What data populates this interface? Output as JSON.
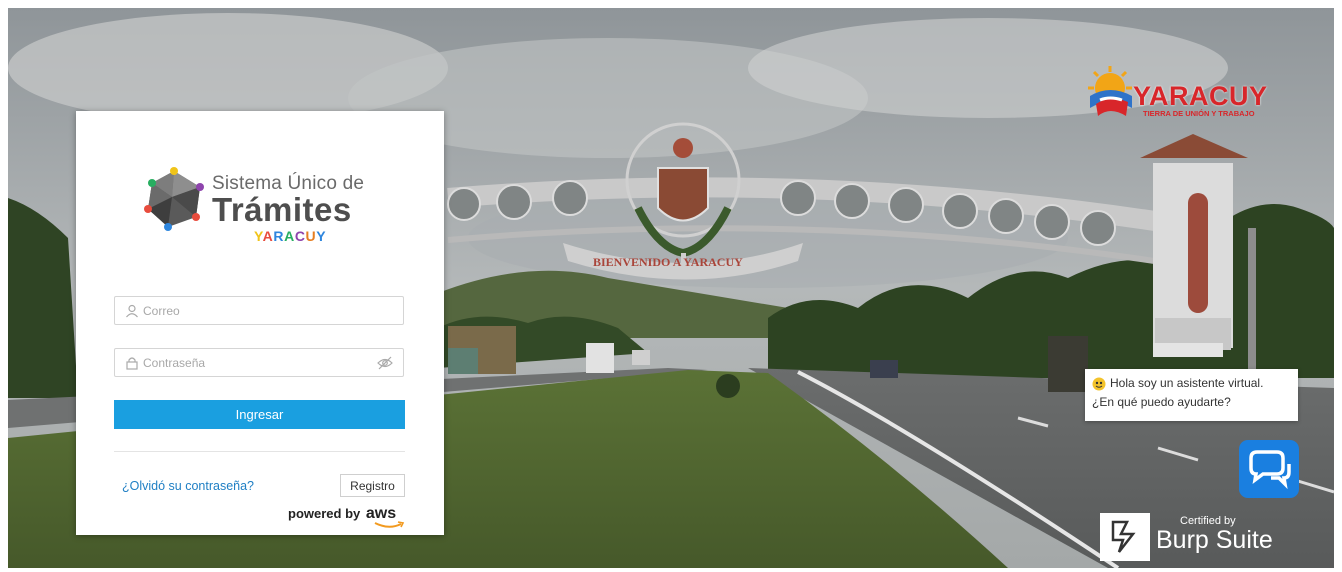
{
  "logo": {
    "line1": "Sistema Único de",
    "line2": "Trámites",
    "line3_letters": [
      "Y",
      "A",
      "R",
      "A",
      "C",
      "U",
      "Y"
    ]
  },
  "login": {
    "email_placeholder": "Correo",
    "password_placeholder": "Contraseña",
    "submit_label": "Ingresar",
    "forgot_label": "¿Olvidó su contraseña?",
    "register_label": "Registro",
    "powered_by": "powered by",
    "aws": "aws",
    "accent_color": "#1a9fe0"
  },
  "background": {
    "arch_banner": "BIENVENIDO A YARACUY"
  },
  "brand": {
    "name": "YARACUY",
    "tagline": "TIERRA DE UNIÓN Y TRABAJO",
    "color": "#d8262a"
  },
  "chat": {
    "line1": "Hola soy un asistente virtual.",
    "line2": "¿En qué puedo ayudarte?",
    "button_icon": "chat-bubbles-icon",
    "button_color": "#1a7fe0"
  },
  "badge": {
    "certified_by": "Certified by",
    "name": "Burp Suite"
  }
}
